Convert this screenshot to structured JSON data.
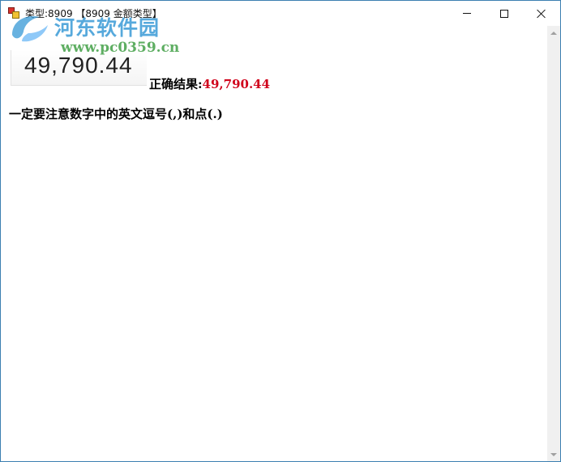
{
  "window": {
    "title": "类型:8909 【8909 金额类型】",
    "app_icon": "app-icon",
    "controls": [
      "minimize-icon",
      "maximize-icon",
      "close-icon"
    ]
  },
  "watermark": {
    "name": "河东软件园",
    "url": "www.pc0359.cn"
  },
  "captcha": {
    "image_text": "49,790.44"
  },
  "result": {
    "label": "正确结果:",
    "value": "49,790.44",
    "value_color": "#d0021b"
  },
  "note": {
    "text": "一定要注意数字中的英文逗号(,)和点(.)"
  }
}
